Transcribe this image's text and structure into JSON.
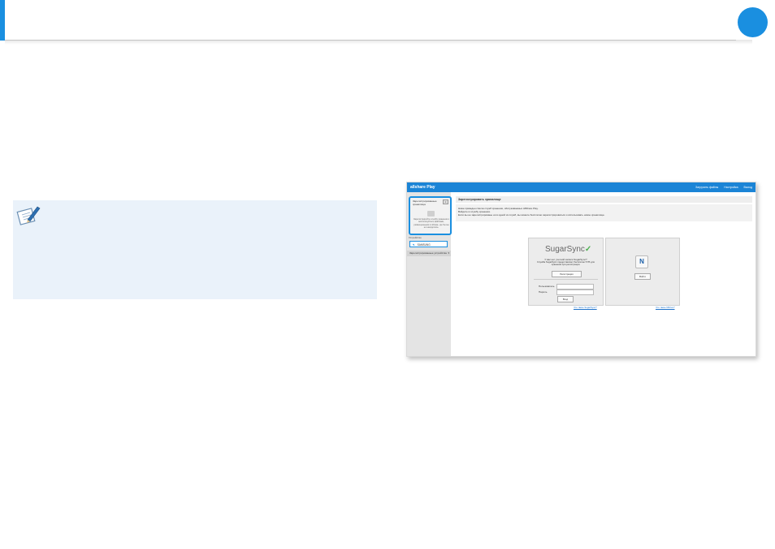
{
  "colors": {
    "accent": "#1a8fe0",
    "note_bg": "#eaf2fa",
    "topbar": "#1b84d6"
  },
  "icons": {
    "note": "note-pencil-icon",
    "device": "device-icon",
    "close": "close-icon",
    "service_n": "n-service-icon"
  },
  "screenshot": {
    "brand": "allshare Play",
    "nav": [
      "Загрузить файлы",
      "Настройка",
      "Выход"
    ],
    "sidebar": {
      "panel_title": "Зарегистрированные хранилища",
      "panel_close": "×",
      "panel_desc": "Зарегистрируйте службу хранения и воспользуйтесь файлами, размещенными в облаке, где бы вы ни находились.",
      "section1": "Устройство",
      "item_label": "SAMSUNG",
      "item_icon": "✎",
      "section2": "Зарегистрированные устройства",
      "section2_chevron": "▾"
    },
    "main": {
      "title": "Зарегистрировать хранилище",
      "desc_lines": [
        "Ниже приведен список служб хранения, обслуживаемых AllShare Play.",
        "Войдите в службу хранения.",
        "Если вы не зарегистрированы ни в одной из служб, вы можете бесплатно зарегистрироваться и использовать новое хранилище."
      ]
    },
    "sugarsync": {
      "logo": "SugarSync",
      "logo_mark": "✓",
      "question": "У вас нет учетной записи SugarSync?",
      "offer": "Служба SugarSync предоставляет бесплатно 5 ГБ для хранения при регистрации.",
      "register_button": "Регистрация",
      "username_label": "Пользователь",
      "password_label": "Пароль",
      "login_button": "Вход",
      "link": "Что такое SugarSync?"
    },
    "n_service": {
      "icon_letter": "N",
      "button": "Войти",
      "link": "Что такое NDrive?"
    }
  }
}
